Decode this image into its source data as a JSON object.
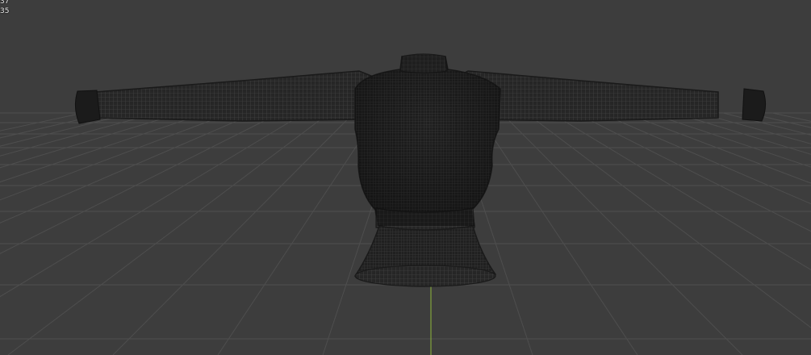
{
  "viewport": {
    "background_color": "#3d3d3d",
    "grid_color": "#4e4e4e",
    "y_axis_color": "#8fb83a",
    "mesh_color": "#1e1e1e",
    "wire_color": "#4a4a4a",
    "object": "sweater-mesh"
  },
  "stats": {
    "line1": "37",
    "line2": "35"
  }
}
